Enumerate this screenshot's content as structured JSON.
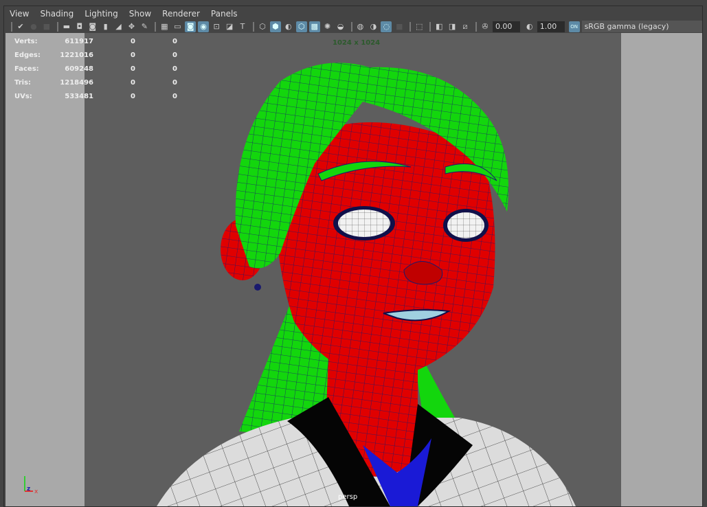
{
  "menu": [
    "View",
    "Shading",
    "Lighting",
    "Show",
    "Renderer",
    "Panels"
  ],
  "toolbar": {
    "groups": [
      [
        {
          "icon": "select-camera-icon",
          "g": "✔"
        },
        {
          "icon": "camera-attributes-icon",
          "g": "●",
          "dim": true
        },
        {
          "icon": "bookmark-icon",
          "g": "■",
          "dim": true
        }
      ],
      [
        {
          "icon": "camera-icon",
          "g": "▬"
        },
        {
          "icon": "lock-camera-icon",
          "g": "◘"
        },
        {
          "icon": "camera-snapshot-icon",
          "g": "◙"
        },
        {
          "icon": "bookmark-flag-icon",
          "g": "▮"
        },
        {
          "icon": "image-plane-icon",
          "g": "◢"
        },
        {
          "icon": "2d-pan-zoom-icon",
          "g": "✥"
        },
        {
          "icon": "grease-pencil-icon",
          "g": "✎"
        }
      ],
      [
        {
          "icon": "grid-icon",
          "g": "▦"
        },
        {
          "icon": "film-gate-icon",
          "g": "▭"
        },
        {
          "icon": "resolution-gate-icon",
          "g": "◙",
          "on": true
        },
        {
          "icon": "gate-mask-icon",
          "g": "◉",
          "on": true
        },
        {
          "icon": "field-chart-icon",
          "g": "⊡"
        },
        {
          "icon": "safe-action-icon",
          "g": "◪"
        },
        {
          "icon": "safe-title-icon",
          "g": "T"
        }
      ],
      [
        {
          "icon": "wireframe-icon",
          "g": "⬡"
        },
        {
          "icon": "smooth-shade-icon",
          "g": "⬢",
          "on": true
        },
        {
          "icon": "default-material-icon",
          "g": "◐"
        },
        {
          "icon": "wireframe-on-shaded-icon",
          "g": "⬡",
          "on": true
        },
        {
          "icon": "xray-icon",
          "g": "▩",
          "on": true
        },
        {
          "icon": "use-all-lights-icon",
          "g": "✺"
        },
        {
          "icon": "shadows-icon",
          "g": "◒"
        }
      ],
      [
        {
          "icon": "screen-space-ao-icon",
          "g": "◍"
        },
        {
          "icon": "motion-blur-icon",
          "g": "◑"
        },
        {
          "icon": "multisample-aa-icon",
          "g": "◌",
          "on": true
        },
        {
          "icon": "depth-of-field-icon",
          "g": "■",
          "dim": true
        }
      ],
      [
        {
          "icon": "isolate-select-icon",
          "g": "⬚"
        }
      ],
      [
        {
          "icon": "xray-joints-icon",
          "g": "◧"
        },
        {
          "icon": "xray-active-icon",
          "g": "◨"
        },
        {
          "icon": "backface-culling-icon",
          "g": "⧄"
        }
      ]
    ],
    "exposure_icon": "exposure-icon",
    "exposure": "0.00",
    "gamma_icon": "gamma-icon",
    "gamma": "1.00",
    "color_management_icon": "color-management-on-icon",
    "color_management_label": "ON",
    "color_space": "sRGB gamma (legacy)"
  },
  "hud": {
    "rows": [
      {
        "label": "Verts:",
        "value": "611917",
        "sel": "0",
        "comp": "0"
      },
      {
        "label": "Edges:",
        "value": "1221016",
        "sel": "0",
        "comp": "0"
      },
      {
        "label": "Faces:",
        "value": "609248",
        "sel": "0",
        "comp": "0"
      },
      {
        "label": "Tris:",
        "value": "1218496",
        "sel": "0",
        "comp": "0"
      },
      {
        "label": "UVs:",
        "value": "533481",
        "sel": "0",
        "comp": "0"
      }
    ],
    "resolution": "1024 x 1024",
    "camera": "persp",
    "axis": {
      "y": "y",
      "z": "z",
      "x": "x"
    }
  },
  "colors": {
    "hair": "#13d60d",
    "skin": "#e00000",
    "shirt": "#d9d9d9",
    "collar": "#050505",
    "inner": "#1a1ad6",
    "wire": "#1a1a6e",
    "active": "#5d8aa6"
  }
}
